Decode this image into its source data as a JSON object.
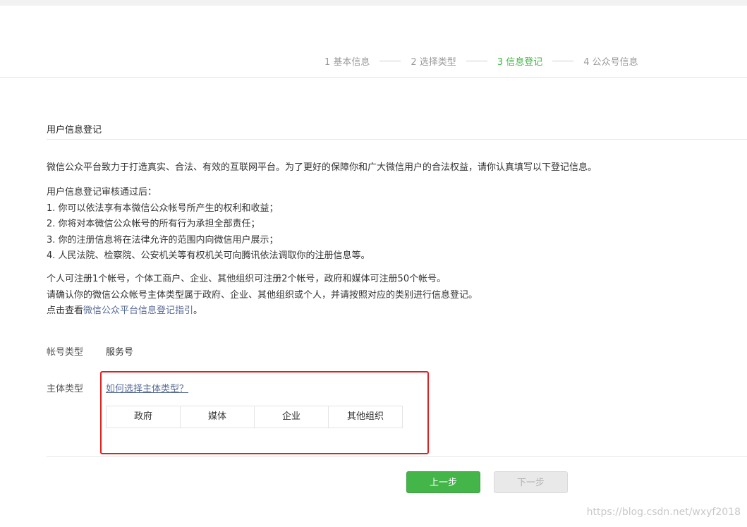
{
  "steps": [
    {
      "label": "1 基本信息"
    },
    {
      "label": "2 选择类型"
    },
    {
      "label": "3 信息登记"
    },
    {
      "label": "4 公众号信息"
    }
  ],
  "section_title": "用户信息登记",
  "intro": "微信公众平台致力于打造真实、合法、有效的互联网平台。为了更好的保障你和广大微信用户的合法权益，请你认真填写以下登记信息。",
  "after_review": {
    "heading": "用户信息登记审核通过后：",
    "items": [
      "1. 你可以依法享有本微信公众帐号所产生的权利和收益；",
      "2. 你将对本微信公众帐号的所有行为承担全部责任；",
      "3. 你的注册信息将在法律允许的范围内向微信用户展示；",
      "4. 人民法院、检察院、公安机关等有权机关可向腾讯依法调取你的注册信息等。"
    ]
  },
  "notes": {
    "line1": "个人可注册1个帐号，个体工商户、企业、其他组织可注册2个帐号，政府和媒体可注册50个帐号。",
    "line2": "请确认你的微信公众帐号主体类型属于政府、企业、其他组织或个人，并请按照对应的类别进行信息登记。",
    "line3_prefix": "点击查看",
    "line3_link": "微信公众平台信息登记指引",
    "line3_suffix": "。"
  },
  "account_type": {
    "label": "帐号类型",
    "value": "服务号"
  },
  "entity_type": {
    "label": "主体类型",
    "help_link": "如何选择主体类型？",
    "options": [
      "政府",
      "媒体",
      "企业",
      "其他组织"
    ]
  },
  "buttons": {
    "prev": "上一步",
    "next": "下一步"
  },
  "watermark": "https://blog.csdn.net/wxyf2018",
  "colors": {
    "accent": "#44b549",
    "link": "#576b95",
    "highlight": "#e02020"
  }
}
